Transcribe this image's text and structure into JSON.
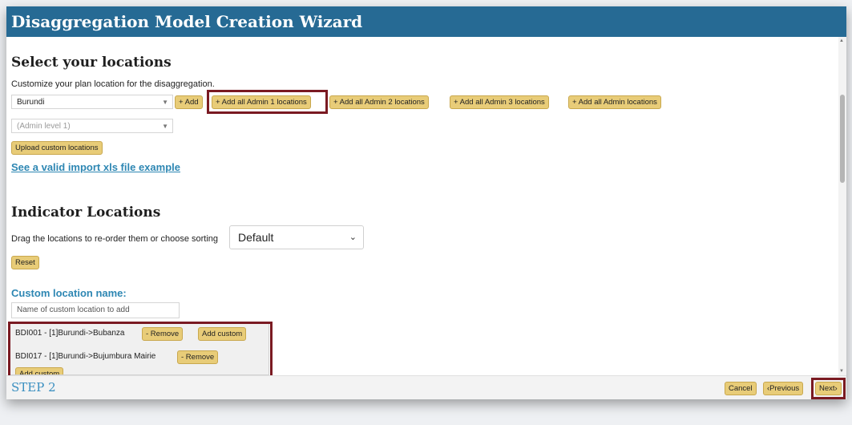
{
  "window_title": "Disaggregation Model Creation Wizard",
  "locations": {
    "heading": "Select your locations",
    "hint": "Customize your plan location for the disaggregation.",
    "country_select": "Burundi",
    "add_label": "+ Add",
    "add_admin1": "+ Add all Admin 1 locations",
    "add_admin2": "+ Add all Admin 2 locations",
    "add_admin3": "+ Add all Admin 3 locations",
    "add_all_admin": "+ Add all Admin locations",
    "admin_level_select": "(Admin level 1)",
    "upload_label": "Upload custom locations",
    "import_link": "See a valid import xls file example"
  },
  "indicator": {
    "heading": "Indicator Locations",
    "hint": "Drag the locations to re-order them or choose sorting",
    "sort_value": "Default",
    "reset_label": "Reset",
    "custom_label": "Custom location name:",
    "custom_placeholder": "Name of custom location to add",
    "items": [
      {
        "name": "BDI001 - [1]Burundi->Bubanza",
        "remove": "- Remove",
        "add_custom": "Add custom"
      },
      {
        "name": "BDI017 - [1]Burundi->Bujumbura Mairie",
        "remove": "- Remove",
        "add_custom": "Add custom"
      }
    ]
  },
  "footer": {
    "step": "STEP 2",
    "cancel": "Cancel",
    "previous": "‹Previous",
    "next": "Next›"
  },
  "colors": {
    "titlebar": "#266a94",
    "button": "#e8cc78",
    "highlight": "#7a1a22",
    "link": "#2e87b3"
  },
  "icons": [
    "dropdown-caret-icon",
    "scroll-up-icon",
    "scroll-down-icon"
  ]
}
